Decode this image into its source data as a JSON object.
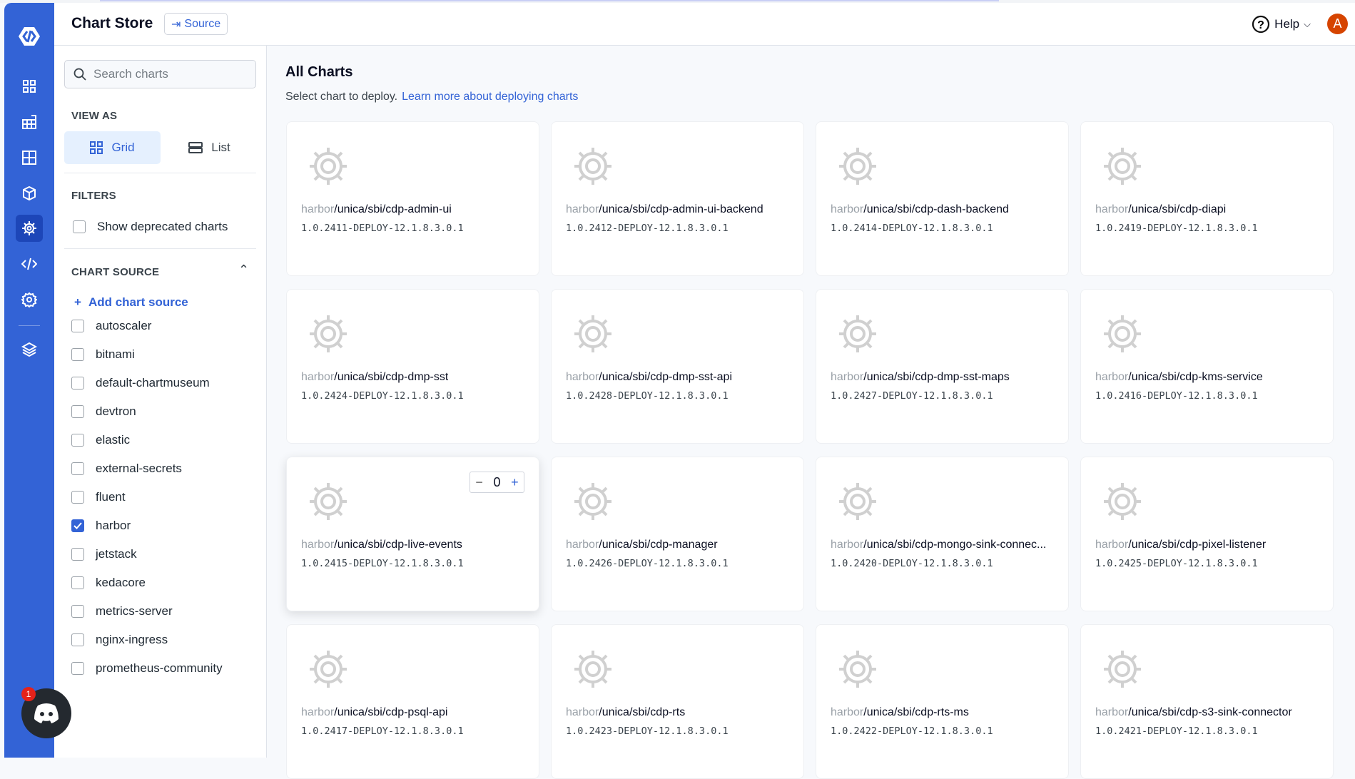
{
  "header": {
    "title": "Chart Store",
    "source_label": "Source",
    "help_label": "Help",
    "avatar_letter": "A"
  },
  "left": {
    "search_placeholder": "Search charts",
    "view_as": "VIEW AS",
    "grid": "Grid",
    "list": "List",
    "filters": "FILTERS",
    "show_deprecated": "Show deprecated charts",
    "chart_source": "CHART SOURCE",
    "add_source": "Add chart source",
    "sources": [
      {
        "label": "autoscaler",
        "checked": false
      },
      {
        "label": "bitnami",
        "checked": false
      },
      {
        "label": "default-chartmuseum",
        "checked": false
      },
      {
        "label": "devtron",
        "checked": false
      },
      {
        "label": "elastic",
        "checked": false
      },
      {
        "label": "external-secrets",
        "checked": false
      },
      {
        "label": "fluent",
        "checked": false
      },
      {
        "label": "harbor",
        "checked": true
      },
      {
        "label": "jetstack",
        "checked": false
      },
      {
        "label": "kedacore",
        "checked": false
      },
      {
        "label": "metrics-server",
        "checked": false
      },
      {
        "label": "nginx-ingress",
        "checked": false
      },
      {
        "label": "prometheus-community",
        "checked": false
      }
    ]
  },
  "main": {
    "title": "All Charts",
    "subtitle": "Select chart to deploy.",
    "learn_link": "Learn more about deploying charts",
    "stepper_value": "0",
    "charts": [
      {
        "repo": "harbor",
        "path": "/unica/sbi/cdp-admin-ui",
        "version": "1.0.2411-DEPLOY-12.1.8.3.0.1"
      },
      {
        "repo": "harbor",
        "path": "/unica/sbi/cdp-admin-ui-backend",
        "version": "1.0.2412-DEPLOY-12.1.8.3.0.1"
      },
      {
        "repo": "harbor",
        "path": "/unica/sbi/cdp-dash-backend",
        "version": "1.0.2414-DEPLOY-12.1.8.3.0.1"
      },
      {
        "repo": "harbor",
        "path": "/unica/sbi/cdp-diapi",
        "version": "1.0.2419-DEPLOY-12.1.8.3.0.1"
      },
      {
        "repo": "harbor",
        "path": "/unica/sbi/cdp-dmp-sst",
        "version": "1.0.2424-DEPLOY-12.1.8.3.0.1"
      },
      {
        "repo": "harbor",
        "path": "/unica/sbi/cdp-dmp-sst-api",
        "version": "1.0.2428-DEPLOY-12.1.8.3.0.1"
      },
      {
        "repo": "harbor",
        "path": "/unica/sbi/cdp-dmp-sst-maps",
        "version": "1.0.2427-DEPLOY-12.1.8.3.0.1"
      },
      {
        "repo": "harbor",
        "path": "/unica/sbi/cdp-kms-service",
        "version": "1.0.2416-DEPLOY-12.1.8.3.0.1"
      },
      {
        "repo": "harbor",
        "path": "/unica/sbi/cdp-live-events",
        "version": "1.0.2415-DEPLOY-12.1.8.3.0.1"
      },
      {
        "repo": "harbor",
        "path": "/unica/sbi/cdp-manager",
        "version": "1.0.2426-DEPLOY-12.1.8.3.0.1"
      },
      {
        "repo": "harbor",
        "path": "/unica/sbi/cdp-mongo-sink-connec...",
        "version": "1.0.2420-DEPLOY-12.1.8.3.0.1"
      },
      {
        "repo": "harbor",
        "path": "/unica/sbi/cdp-pixel-listener",
        "version": "1.0.2425-DEPLOY-12.1.8.3.0.1"
      },
      {
        "repo": "harbor",
        "path": "/unica/sbi/cdp-psql-api",
        "version": "1.0.2417-DEPLOY-12.1.8.3.0.1"
      },
      {
        "repo": "harbor",
        "path": "/unica/sbi/cdp-rts",
        "version": "1.0.2423-DEPLOY-12.1.8.3.0.1"
      },
      {
        "repo": "harbor",
        "path": "/unica/sbi/cdp-rts-ms",
        "version": "1.0.2422-DEPLOY-12.1.8.3.0.1"
      },
      {
        "repo": "harbor",
        "path": "/unica/sbi/cdp-s3-sink-connector",
        "version": "1.0.2421-DEPLOY-12.1.8.3.0.1"
      }
    ]
  },
  "discord": {
    "badge": "1"
  }
}
